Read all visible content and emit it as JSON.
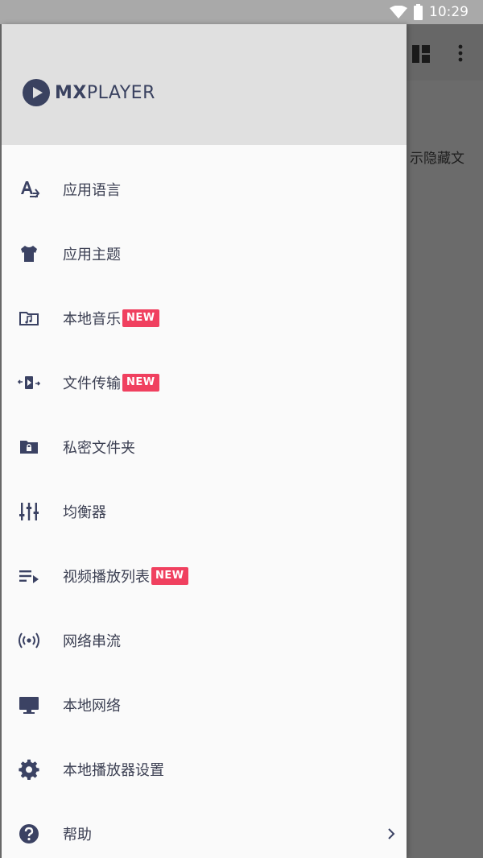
{
  "status_bar": {
    "time": "10:29"
  },
  "behind": {
    "partial_text": "示隐藏文"
  },
  "drawer": {
    "logo": {
      "bold": "MX",
      "light": "PLAYER"
    },
    "badge_text": "NEW",
    "items": [
      {
        "label": "应用语言",
        "icon": "translate-icon",
        "badge": false
      },
      {
        "label": "应用主题",
        "icon": "shirt-icon",
        "badge": false
      },
      {
        "label": "本地音乐",
        "icon": "music-folder-icon",
        "badge": true
      },
      {
        "label": "文件传输",
        "icon": "file-transfer-icon",
        "badge": true
      },
      {
        "label": "私密文件夹",
        "icon": "lock-folder-icon",
        "badge": false
      },
      {
        "label": "均衡器",
        "icon": "equalizer-icon",
        "badge": false
      },
      {
        "label": "视频播放列表",
        "icon": "playlist-icon",
        "badge": true
      },
      {
        "label": "网络串流",
        "icon": "stream-icon",
        "badge": false
      },
      {
        "label": "本地网络",
        "icon": "monitor-icon",
        "badge": false
      },
      {
        "label": "本地播放器设置",
        "icon": "gear-icon",
        "badge": false
      },
      {
        "label": "帮助",
        "icon": "help-icon",
        "badge": false,
        "chevron": true
      }
    ]
  },
  "colors": {
    "accent_badge": "#f0405f",
    "icon": "#3b4263",
    "header": "#e0e0e0"
  }
}
